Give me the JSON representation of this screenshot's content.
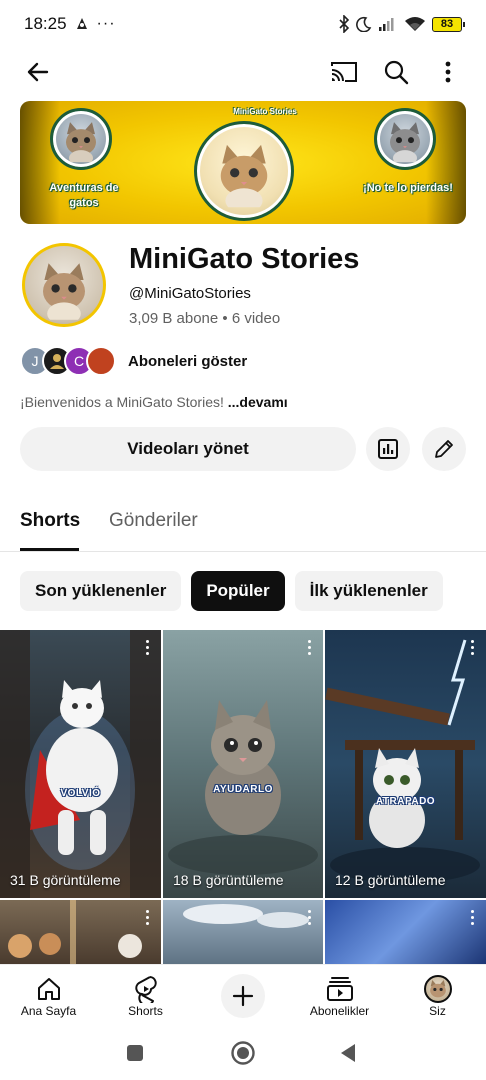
{
  "status_bar": {
    "time": "18:25",
    "more": "···",
    "battery": "83"
  },
  "banner": {
    "arc_text": "MiniGato Stories",
    "left_text": "Aventuras de gatos",
    "right_text": "¡No te lo pierdas!"
  },
  "channel": {
    "name": "MiniGato Stories",
    "handle": "@MiniGatoStories",
    "meta": "3,09 B abone • 6 video",
    "subscribers_label": "Aboneleri göster",
    "subscriber_avatars": [
      {
        "letter": "J",
        "color": "#8193a8"
      },
      {
        "letter": "",
        "color": "#1b1b1b"
      },
      {
        "letter": "C",
        "color": "#8e2fb4"
      },
      {
        "letter": "",
        "color": "#c0421f"
      }
    ],
    "description": "¡Bienvenidos a MiniGato Stories! ",
    "more_label": "...devamı",
    "manage_label": "Videoları yönet"
  },
  "tabs": [
    {
      "label": "Shorts",
      "active": true
    },
    {
      "label": "Gönderiler",
      "active": false
    }
  ],
  "chips": [
    {
      "label": "Son yüklenenler",
      "selected": false
    },
    {
      "label": "Popüler",
      "selected": true
    },
    {
      "label": "İlk yüklenenler",
      "selected": false
    }
  ],
  "shorts": [
    {
      "views": "31 B görüntüleme",
      "caption": "VOLVIÓ"
    },
    {
      "views": "18 B görüntüleme",
      "caption": "AYUDARLO"
    },
    {
      "views": "12 B görüntüleme",
      "caption": "ATRAPADO"
    }
  ],
  "bottom_nav": {
    "home": "Ana Sayfa",
    "shorts": "Shorts",
    "subscriptions": "Abonelikler",
    "you": "Siz"
  },
  "colors": {
    "banner_yellow": "#f2c600",
    "selected_chip": "#0f0f0f",
    "chip_bg": "#f2f2f2"
  },
  "icons": [
    "back-arrow-icon",
    "cast-icon",
    "search-icon",
    "more-vert-icon",
    "analytics-icon",
    "edit-pencil-icon",
    "home-icon",
    "shorts-icon",
    "plus-icon",
    "subscriptions-icon"
  ]
}
